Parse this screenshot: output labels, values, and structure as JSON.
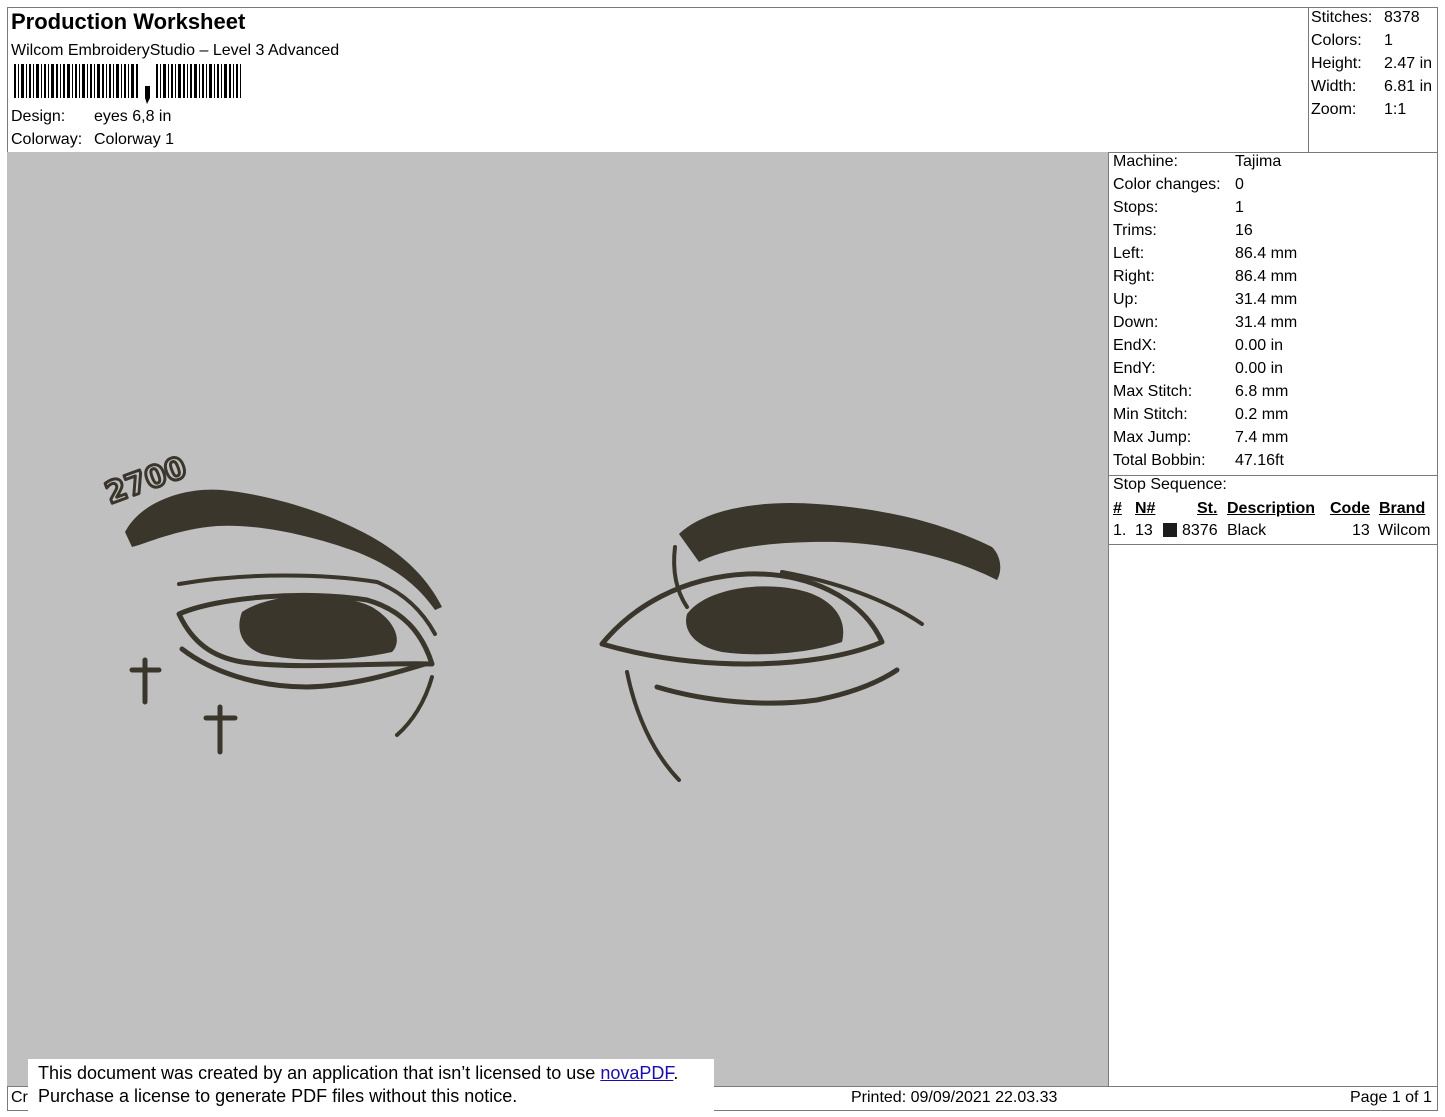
{
  "header": {
    "title": "Production Worksheet",
    "software": "Wilcom EmbroideryStudio – Level 3 Advanced",
    "design_label": "Design:",
    "design_value": "eyes 6,8 in",
    "colorway_label": "Colorway:",
    "colorway_value": "Colorway 1"
  },
  "summary": [
    {
      "label": "Stitches:",
      "value": "8378"
    },
    {
      "label": "Colors:",
      "value": "1"
    },
    {
      "label": "Height:",
      "value": "2.47 in"
    },
    {
      "label": "Width:",
      "value": "6.81 in"
    },
    {
      "label": "Zoom:",
      "value": "1:1"
    }
  ],
  "machine_info": [
    {
      "label": "Machine:",
      "value": "Tajima"
    },
    {
      "label": "Color changes:",
      "value": "0"
    },
    {
      "label": "Stops:",
      "value": "1"
    },
    {
      "label": "Trims:",
      "value": "16"
    },
    {
      "label": "Left:",
      "value": "86.4 mm"
    },
    {
      "label": "Right:",
      "value": "86.4 mm"
    },
    {
      "label": "Up:",
      "value": "31.4 mm"
    },
    {
      "label": "Down:",
      "value": "31.4 mm"
    },
    {
      "label": "EndX:",
      "value": "0.00 in"
    },
    {
      "label": "EndY:",
      "value": "0.00 in"
    },
    {
      "label": "Max Stitch:",
      "value": "6.8 mm"
    },
    {
      "label": "Min Stitch:",
      "value": "0.2 mm"
    },
    {
      "label": "Max Jump:",
      "value": "7.4 mm"
    },
    {
      "label": "Total Bobbin:",
      "value": "47.16ft"
    }
  ],
  "stop_sequence": {
    "title": "Stop Sequence:",
    "columns": {
      "num": "#",
      "needle": "N#",
      "stitches": "St.",
      "description": "Description",
      "code": "Code",
      "brand": "Brand"
    },
    "rows": [
      {
        "num": "1.",
        "needle": "13",
        "stitches": "8376",
        "description": "Black",
        "code": "13",
        "brand": "Wilcom",
        "color": "#1c1c1c"
      }
    ]
  },
  "design_text": "2700",
  "footer": {
    "created_partial": "Cr",
    "printed": "Printed: 09/09/2021 22.03.33",
    "page": "Page 1 of 1"
  },
  "notice": {
    "line1_prefix": "This document was created by an application that isn’t licensed to use ",
    "link": "novaPDF",
    "line1_suffix": ".",
    "line2": "Purchase a license to generate PDF files without this notice."
  },
  "colors": {
    "canvas": "#c0c0c0",
    "thread": "#3a362c"
  }
}
